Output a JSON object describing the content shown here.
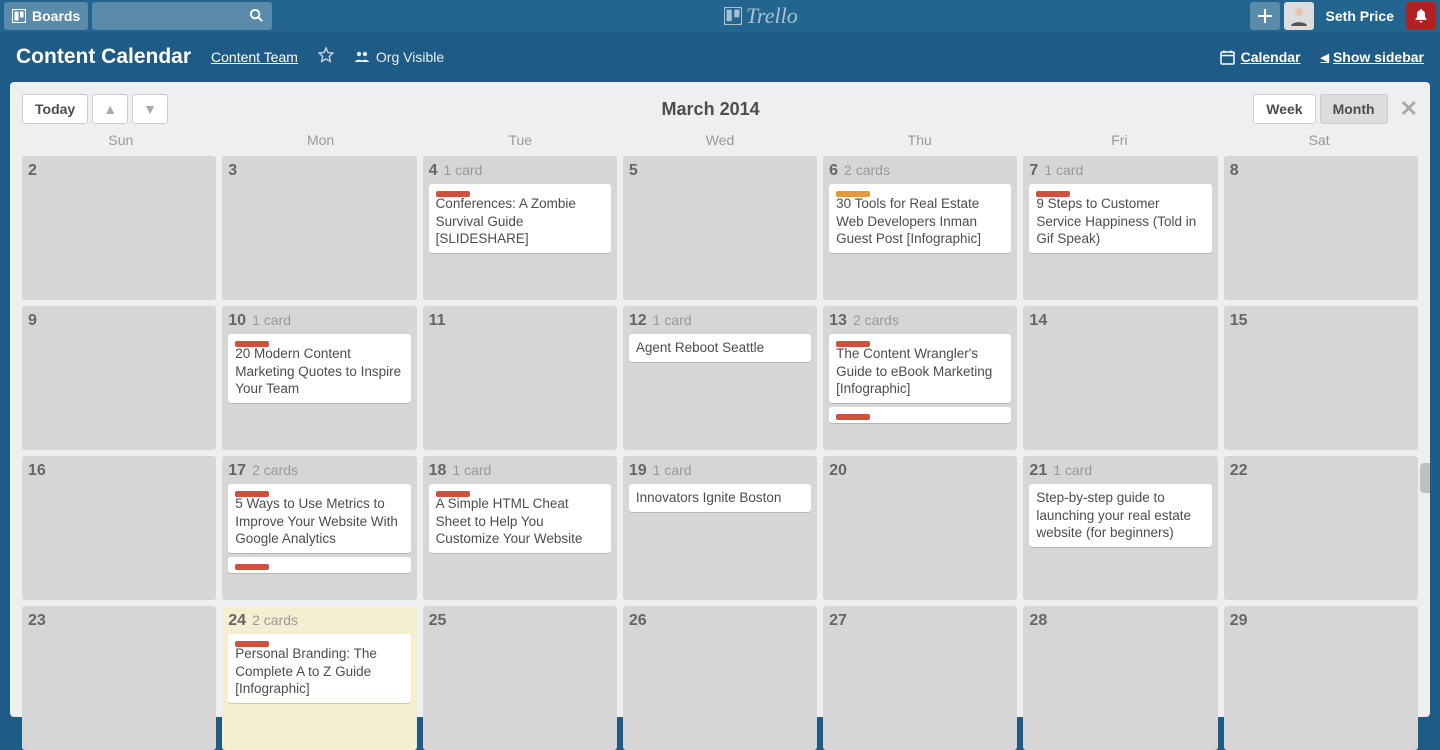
{
  "topbar": {
    "boards_label": "Boards",
    "logo_text": "Trello",
    "username": "Seth Price"
  },
  "board": {
    "title": "Content Calendar",
    "team": "Content Team",
    "visibility_label": "Org Visible",
    "calendar_link": "Calendar",
    "show_sidebar": "Show sidebar"
  },
  "calendar": {
    "today_label": "Today",
    "month_title": "March 2014",
    "week_label": "Week",
    "month_label": "Month",
    "day_names": [
      "Sun",
      "Mon",
      "Tue",
      "Wed",
      "Thu",
      "Fri",
      "Sat"
    ],
    "cells": [
      {
        "date": "2"
      },
      {
        "date": "3"
      },
      {
        "date": "4",
        "count": "1 card",
        "cards": [
          {
            "labels": [
              "red"
            ],
            "text": "Conferences: A Zombie Survival Guide [SLIDESHARE]"
          }
        ]
      },
      {
        "date": "5"
      },
      {
        "date": "6",
        "count": "2 cards",
        "cards": [
          {
            "labels": [
              "orange"
            ],
            "text": "30 Tools for Real Estate Web Developers Inman Guest Post [Infographic]"
          }
        ]
      },
      {
        "date": "7",
        "count": "1 card",
        "cards": [
          {
            "labels": [
              "red"
            ],
            "text": "9 Steps to Customer Service Happiness (Told in Gif Speak)"
          }
        ]
      },
      {
        "date": "8"
      },
      {
        "date": "9"
      },
      {
        "date": "10",
        "count": "1 card",
        "cards": [
          {
            "labels": [
              "red"
            ],
            "text": "20 Modern Content Marketing Quotes to Inspire Your Team"
          }
        ]
      },
      {
        "date": "11"
      },
      {
        "date": "12",
        "count": "1 card",
        "cards": [
          {
            "labels": [],
            "text": "Agent Reboot Seattle"
          }
        ]
      },
      {
        "date": "13",
        "count": "2 cards",
        "cards": [
          {
            "labels": [
              "red"
            ],
            "text": "The Content Wrangler's Guide to eBook Marketing [Infographic]"
          },
          {
            "labels": [
              "red"
            ],
            "text": ""
          }
        ]
      },
      {
        "date": "14"
      },
      {
        "date": "15"
      },
      {
        "date": "16"
      },
      {
        "date": "17",
        "count": "2 cards",
        "cards": [
          {
            "labels": [
              "red"
            ],
            "text": "5 Ways to Use Metrics to Improve Your Website With Google Analytics"
          },
          {
            "labels": [
              "red"
            ],
            "text": ""
          }
        ]
      },
      {
        "date": "18",
        "count": "1 card",
        "cards": [
          {
            "labels": [
              "red"
            ],
            "text": "A Simple HTML Cheat Sheet to Help You Customize Your Website"
          }
        ]
      },
      {
        "date": "19",
        "count": "1 card",
        "cards": [
          {
            "labels": [],
            "text": "Innovators Ignite Boston"
          }
        ]
      },
      {
        "date": "20"
      },
      {
        "date": "21",
        "count": "1 card",
        "cards": [
          {
            "labels": [],
            "text": "Step-by-step guide to launching your real estate website (for beginners)"
          }
        ]
      },
      {
        "date": "22"
      },
      {
        "date": "23"
      },
      {
        "date": "24",
        "count": "2 cards",
        "today": true,
        "cards": [
          {
            "labels": [
              "red"
            ],
            "text": "Personal Branding: The Complete A to Z Guide [Infographic]"
          }
        ]
      },
      {
        "date": "25"
      },
      {
        "date": "26"
      },
      {
        "date": "27"
      },
      {
        "date": "28"
      },
      {
        "date": "29"
      }
    ]
  }
}
